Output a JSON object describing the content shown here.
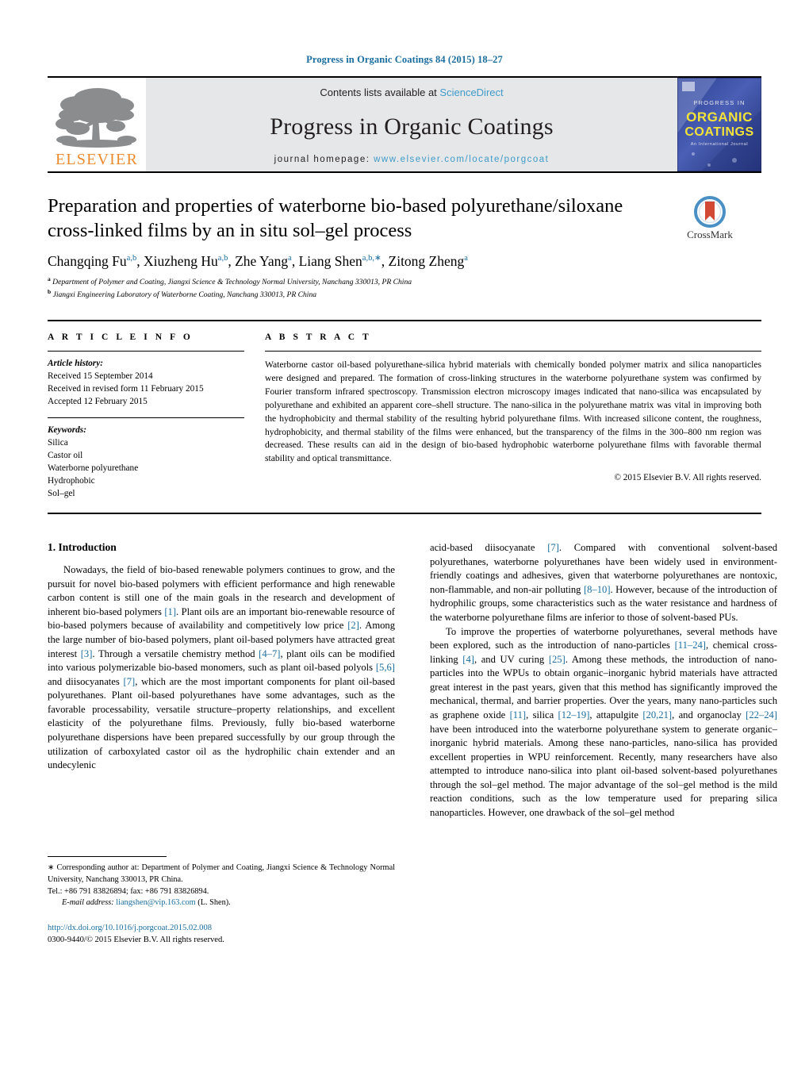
{
  "running_head": "Progress in Organic Coatings 84 (2015) 18–27",
  "banner": {
    "publisher_wordmark": "ELSEVIER",
    "contents_prefix": "Contents lists available at",
    "contents_link": "ScienceDirect",
    "journal_name": "Progress in Organic Coatings",
    "homepage_prefix": "journal homepage:",
    "homepage_url": "www.elsevier.com/locate/porgcoat",
    "cover": {
      "top_line": "PROGRESS IN",
      "title_line1": "ORGANIC",
      "title_line2": "COATINGS",
      "sub_line": "An International Journal"
    }
  },
  "article": {
    "title": "Preparation and properties of waterborne bio-based polyurethane/siloxane cross-linked films by an in situ sol–gel process",
    "crossmark_label": "CrossMark",
    "authors": [
      {
        "name": "Changqing Fu",
        "marks": "a,b",
        "sep": ", "
      },
      {
        "name": "Xiuzheng Hu",
        "marks": "a,b",
        "sep": ", "
      },
      {
        "name": "Zhe Yang",
        "marks": "a",
        "sep": ", "
      },
      {
        "name": "Liang Shen",
        "marks": "a,b,∗",
        "sep": ", "
      },
      {
        "name": "Zitong Zheng",
        "marks": "a",
        "sep": ""
      }
    ],
    "affiliations": [
      {
        "mark": "a",
        "text": "Department of Polymer and Coating, Jiangxi Science & Technology Normal University, Nanchang 330013, PR China"
      },
      {
        "mark": "b",
        "text": "Jiangxi Engineering Laboratory of Waterborne Coating, Nanchang 330013, PR China"
      }
    ]
  },
  "article_info": {
    "heading": "A R T I C L E   I N F O",
    "history_heading": "Article history:",
    "history": [
      "Received 15 September 2014",
      "Received in revised form 11 February 2015",
      "Accepted 12 February 2015"
    ],
    "keywords_heading": "Keywords:",
    "keywords": [
      "Silica",
      "Castor oil",
      "Waterborne polyurethane",
      "Hydrophobic",
      "Sol–gel"
    ]
  },
  "abstract": {
    "heading": "A B S T R A C T",
    "text": "Waterborne castor oil-based polyurethane-silica hybrid materials with chemically bonded polymer matrix and silica nanoparticles were designed and prepared. The formation of cross-linking structures in the waterborne polyurethane system was confirmed by Fourier transform infrared spectroscopy. Transmission electron microscopy images indicated that nano-silica was encapsulated by polyurethane and exhibited an apparent core–shell structure. The nano-silica in the polyurethane matrix was vital in improving both the hydrophobicity and thermal stability of the resulting hybrid polyurethane films. With increased silicone content, the roughness, hydrophobicity, and thermal stability of the films were enhanced, but the transparency of the films in the 300–800 nm region was decreased. These results can aid in the design of bio-based hydrophobic waterborne polyurethane films with favorable thermal stability and optical transmittance.",
    "copyright": "© 2015 Elsevier B.V. All rights reserved."
  },
  "body": {
    "section_heading": "1.  Introduction",
    "left_paragraph_1_parts": [
      {
        "t": "Nowadays, the field of bio-based renewable polymers continues to grow, and the pursuit for novel bio-based polymers with efficient performance and high renewable carbon content is still one of the main goals in the research and development of inherent bio-based polymers "
      },
      {
        "r": "[1]"
      },
      {
        "t": ". Plant oils are an important bio-renewable resource of bio-based polymers because of availability and competitively low price "
      },
      {
        "r": "[2]"
      },
      {
        "t": ". Among the large number of bio-based polymers, plant oil-based polymers have attracted great interest "
      },
      {
        "r": "[3]"
      },
      {
        "t": ". Through a versatile chemistry method "
      },
      {
        "r": "[4–7]"
      },
      {
        "t": ", plant oils can be modified into various polymerizable bio-based monomers, such as plant oil-based polyols "
      },
      {
        "r": "[5,6]"
      },
      {
        "t": " and diisocyanates "
      },
      {
        "r": "[7]"
      },
      {
        "t": ", which are the most important components for plant oil-based polyurethanes. Plant oil-based polyurethanes have some advantages, such as the favorable processability, versatile structure–property relationships, and excellent elasticity of the polyurethane films. Previously, fully bio-based waterborne polyurethane dispersions have been prepared successfully by our group through the utilization of carboxylated castor oil as the hydrophilic chain extender and an undecylenic"
      }
    ],
    "right_paragraph_1_parts": [
      {
        "t": "acid-based diisocyanate "
      },
      {
        "r": "[7]"
      },
      {
        "t": ". Compared with conventional solvent-based polyurethanes, waterborne polyurethanes have been widely used in environment-friendly coatings and adhesives, given that waterborne polyurethanes are nontoxic, non-flammable, and non-air polluting "
      },
      {
        "r": "[8–10]"
      },
      {
        "t": ". However, because of the introduction of hydrophilic groups, some characteristics such as the water resistance and hardness of the waterborne polyurethane films are inferior to those of solvent-based PUs."
      }
    ],
    "right_paragraph_2_parts": [
      {
        "t": "To improve the properties of waterborne polyurethanes, several methods have been explored, such as the introduction of nano-particles "
      },
      {
        "r": "[11–24]"
      },
      {
        "t": ", chemical cross-linking "
      },
      {
        "r": "[4]"
      },
      {
        "t": ", and UV curing "
      },
      {
        "r": "[25]"
      },
      {
        "t": ". Among these methods, the introduction of nano-particles into the WPUs to obtain organic–inorganic hybrid materials have attracted great interest in the past years, given that this method has significantly improved the mechanical, thermal, and barrier properties. Over the years, many nano-particles such as graphene oxide "
      },
      {
        "r": "[11]"
      },
      {
        "t": ", silica "
      },
      {
        "r": "[12–19]"
      },
      {
        "t": ", attapulgite "
      },
      {
        "r": "[20,21]"
      },
      {
        "t": ", and organoclay "
      },
      {
        "r": "[22–24]"
      },
      {
        "t": " have been introduced into the waterborne polyurethane system to generate organic–inorganic hybrid materials. Among these nano-particles, nano-silica has provided excellent properties in WPU reinforcement. Recently, many researchers have also attempted to introduce nano-silica into plant oil-based solvent-based polyurethanes through the sol–gel method. The major advantage of the sol–gel method is the mild reaction conditions, such as the low temperature used for preparing silica nanoparticles. However, one drawback of the sol–gel method"
      }
    ]
  },
  "footnote": {
    "star": "∗",
    "corresponding_text": "Corresponding author at: Department of Polymer and Coating, Jiangxi Science & Technology Normal University, Nanchang 330013, PR China.",
    "tel": "Tel.: +86 791 83826894; fax: +86 791 83826894.",
    "email_label": "E-mail address:",
    "email": "liangshen@vip.163.com",
    "email_owner": "(L. Shen).",
    "doi_url": "http://dx.doi.org/10.1016/j.porgcoat.2015.02.008",
    "issn_line": "0300-9440/© 2015 Elsevier B.V. All rights reserved."
  },
  "colors": {
    "link_blue": "#1a6d9e",
    "sd_blue": "#3f9bc9",
    "elsevier_orange": "#eb8b2e",
    "banner_grey": "#e6e7e8",
    "crossmark_blue": "#4a90c4",
    "crossmark_red": "#d24a36"
  }
}
